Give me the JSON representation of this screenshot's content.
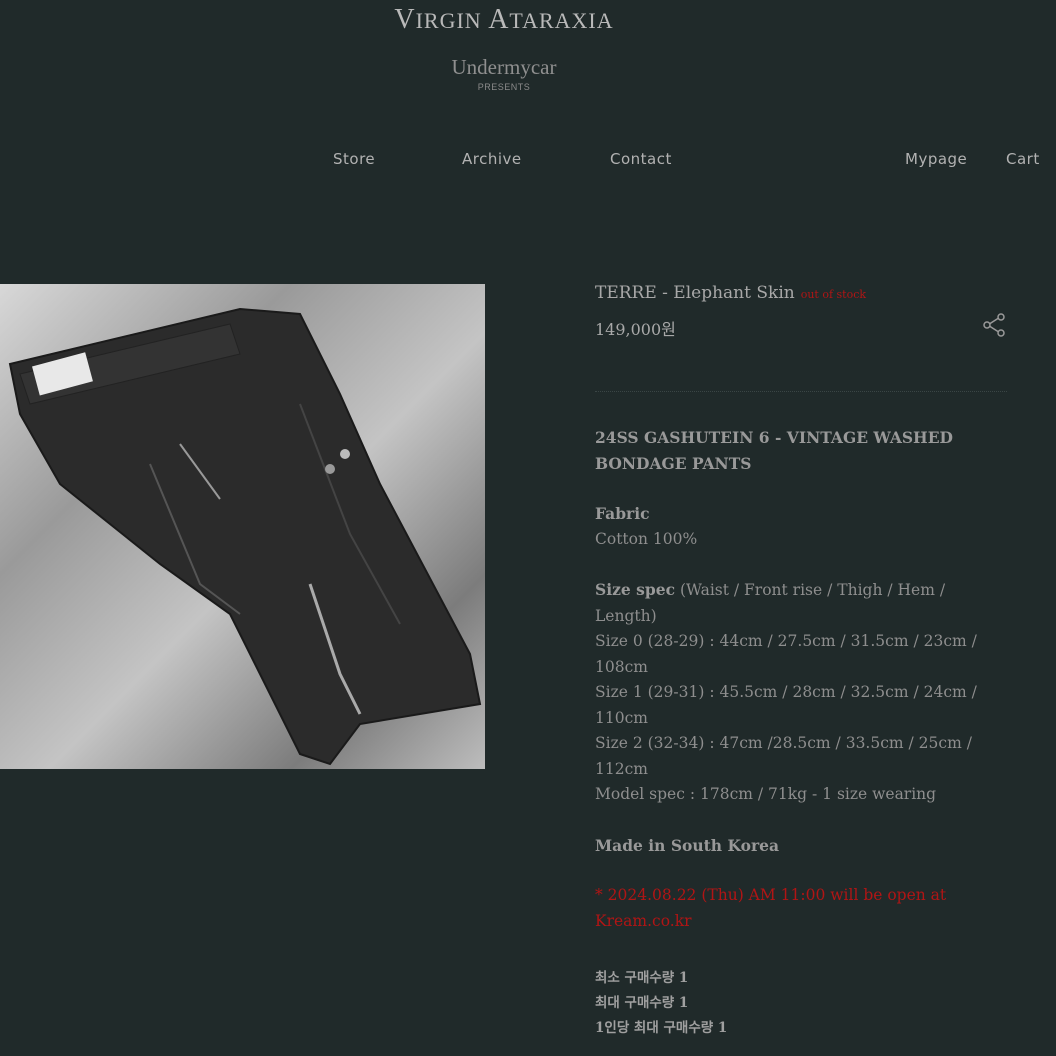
{
  "brand": {
    "logo_first": "V",
    "logo_first_rest": "IRGIN",
    "logo_second": "A",
    "logo_second_rest": "TARAXIA",
    "sub_name": "Undermycar",
    "presents": "PRESENTS"
  },
  "nav": {
    "store": "Store",
    "archive": "Archive",
    "contact": "Contact",
    "mypage": "Mypage",
    "cart": "Cart"
  },
  "product": {
    "title": "TERRE - Elephant Skin",
    "stock_status": "out of stock",
    "price": "149,000원",
    "heading": "24SS GASHUTEIN 6 - VINTAGE WASHED BONDAGE PANTS",
    "fabric_label": "Fabric",
    "fabric": "Cotton 100%",
    "size_spec_label": "Size spec",
    "size_spec_columns": "(Waist / Front rise / Thigh / Hem / Length)",
    "sizes": [
      "Size 0 (28-29) : 44cm / 27.5cm / 31.5cm / 23cm / 108cm",
      "Size 1 (29-31) : 45.5cm / 28cm / 32.5cm / 24cm / 110cm",
      "Size 2 (32-34) : 47cm /28.5cm / 33.5cm / 25cm / 112cm"
    ],
    "model_spec": "Model spec : 178cm / 71kg - 1 size wearing",
    "origin": "Made in South Korea",
    "notice": "* 2024.08.22 (Thu) AM 11:00 will be open at Kream.co.kr",
    "min_qty": "최소 구매수량 1",
    "max_qty": "최대 구매수량 1",
    "per_person_qty": "1인당 최대 구매수량 1"
  },
  "colors": {
    "background": "#202a2a",
    "accent_red": "#b01515"
  }
}
